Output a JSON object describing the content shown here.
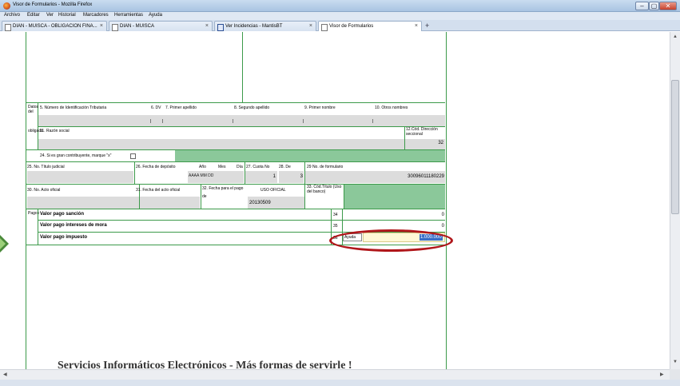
{
  "window": {
    "title": "Visor de Formularios - Mozilla Firefox",
    "controls": [
      "–",
      "▢",
      "✕"
    ]
  },
  "menu": [
    "Archivo",
    "Editar",
    "Ver",
    "Historial",
    "Marcadores",
    "Herramientas",
    "Ayuda"
  ],
  "tabs": [
    {
      "label": "DIAN - MUISCA - OBLIGACION FINA...",
      "close": "×",
      "active": false
    },
    {
      "label": "DIAN - MUISCA",
      "close": "×",
      "active": false
    },
    {
      "label": "Ver Incidencias - MantisBT",
      "close": "×",
      "active": false
    },
    {
      "label": "Visor de Formularios",
      "close": "×",
      "active": true
    }
  ],
  "new_tab": "+",
  "form": {
    "section_datos": "Datos del",
    "section_datos_cont": "obligado",
    "f5": "5. Número de Identificación Tributaria",
    "f6": "6. DV",
    "f7": "7. Primer apellido",
    "f8": "8. Segundo apellido",
    "f9": "9. Primer nombre",
    "f10": "10. Otros nombres",
    "f11": "11. Razón social",
    "f12": "12.Cód. Dirección seccional",
    "f12_value": "32",
    "f24": "24. Si es gran contribuyente, marque \"x\"",
    "f25": "25. No. Título judicial",
    "f26": "26. Fecha de depósito",
    "f26_ano": "Año",
    "f26_mes": "Mes",
    "f26_dia": "Día",
    "f26_format": "AAAA MM DD",
    "f27": "27. Cuota No",
    "f27_value": "1",
    "f28": "28. De",
    "f28_value": "3",
    "f29": "29 No. de formulario",
    "f29_value": "30096011180229",
    "f30": "30. No. Acto oficial",
    "f31": "31. Fecha del acto oficial",
    "f32": "32. Fecha para el pago de",
    "f32_value": "20130509",
    "uso_oficial": "USO OFICIAL",
    "f33": "33. Cód.Título (Uso del banco)",
    "section_pagos": "Pagos",
    "r34_label": "Valor pago sanción",
    "r34_num": "34",
    "r34_value": "0",
    "r35_label": "Valor pago intereses de mora",
    "r35_num": "35",
    "r35_value": "0",
    "r36_label": "Valor pago impuesto",
    "r36_num": "36",
    "r36_help": "Ayuda",
    "r36_value": "1.000.000"
  },
  "footer": "Servicios Informáticos Electrónicos  -  Más formas de servirle !"
}
